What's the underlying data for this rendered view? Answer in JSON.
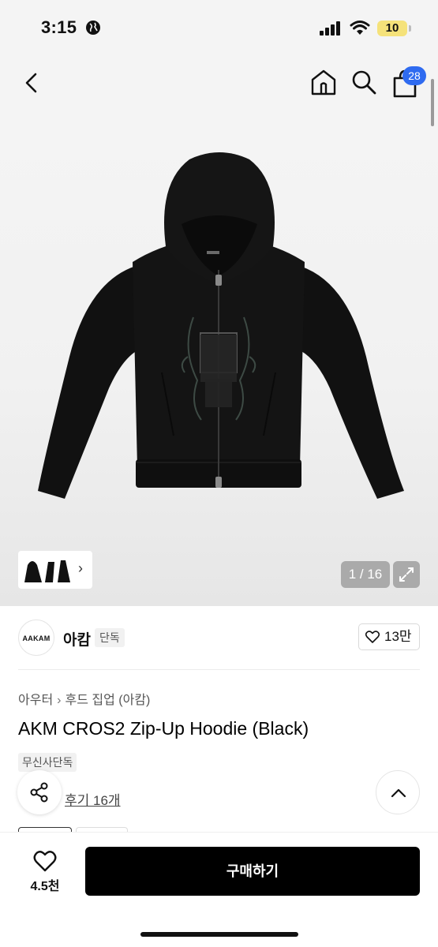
{
  "status_bar": {
    "time": "3:15",
    "battery": "10",
    "icons": [
      "globe-icon",
      "signal-icon",
      "wifi-icon",
      "battery-icon"
    ]
  },
  "nav": {
    "icons": [
      "back-icon",
      "home-icon",
      "search-icon",
      "cart-icon"
    ],
    "cart_badge": "28"
  },
  "gallery": {
    "page_counter": "1 / 16",
    "thumb_arrow": "›",
    "icons": [
      "expand-icon"
    ]
  },
  "brand": {
    "logo_text": "AAKAM",
    "name": "아캄",
    "tag": "단독",
    "like_count": "13만"
  },
  "product": {
    "breadcrumb": [
      "아우터",
      "후드 집업 (아캄)"
    ],
    "title": "AKM CROS2 Zip-Up Hoodie (Black)",
    "exclusive_badge": "무신사단독",
    "review_link": "후기 16개"
  },
  "bottom_bar": {
    "wish_count": "4.5천",
    "buy_label": "구매하기"
  },
  "colors": {
    "accent_badge": "#2f6bf0",
    "buy_button": "#000000",
    "hero_background": "#f1f1f1",
    "battery": "#f5e27a"
  }
}
